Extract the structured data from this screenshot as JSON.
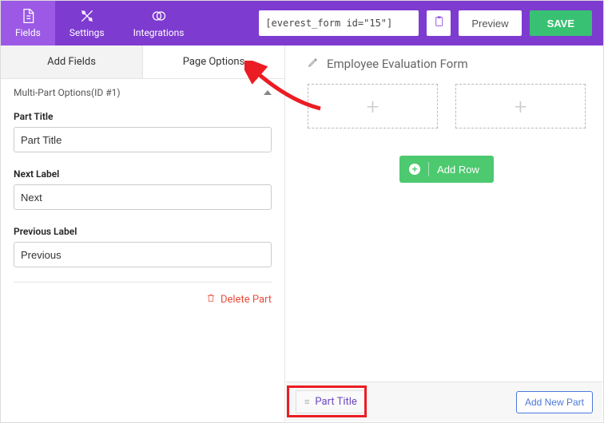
{
  "topnav": {
    "fields": "Fields",
    "settings": "Settings",
    "integrations": "Integrations",
    "shortcode": "[everest_form id=\"15\"]",
    "preview": "Preview",
    "save": "SAVE"
  },
  "tabs": {
    "add_fields": "Add Fields",
    "page_options": "Page Options"
  },
  "section": {
    "title": "Multi-Part Options(ID #1)"
  },
  "fields": {
    "part_title_label": "Part Title",
    "part_title_value": "Part Title",
    "next_label_label": "Next Label",
    "next_label_value": "Next",
    "previous_label_label": "Previous Label",
    "previous_label_value": "Previous"
  },
  "actions": {
    "delete_part": "Delete Part"
  },
  "canvas": {
    "form_title": "Employee Evaluation Form",
    "add_row": "Add Row"
  },
  "parts": {
    "part1_label": "Part Title",
    "add_new": "Add New Part"
  }
}
